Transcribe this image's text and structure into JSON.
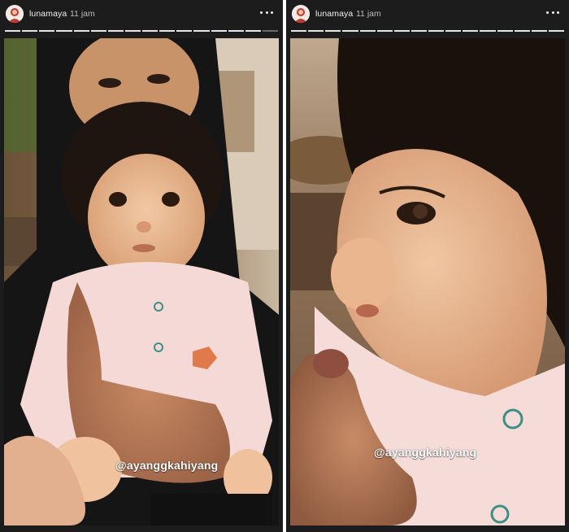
{
  "stories": [
    {
      "username": "lunamaya",
      "time": "11 jam",
      "mention": "@ayanggkahiyang",
      "segments_total": 16,
      "segments_done": 15,
      "icons": [
        "avatar-icon",
        "more-options-icon"
      ]
    },
    {
      "username": "lunamaya",
      "time": "11 jam",
      "mention": "@ayanggkahiyang",
      "segments_total": 16,
      "segments_done": 16,
      "icons": [
        "avatar-icon",
        "more-options-icon"
      ]
    }
  ],
  "colors": {
    "frame_background": "#1c1c1c",
    "progress_done": "#e6e6e6",
    "progress_pending": "#6a6a6a",
    "avatar_accent": "#c0392b"
  }
}
